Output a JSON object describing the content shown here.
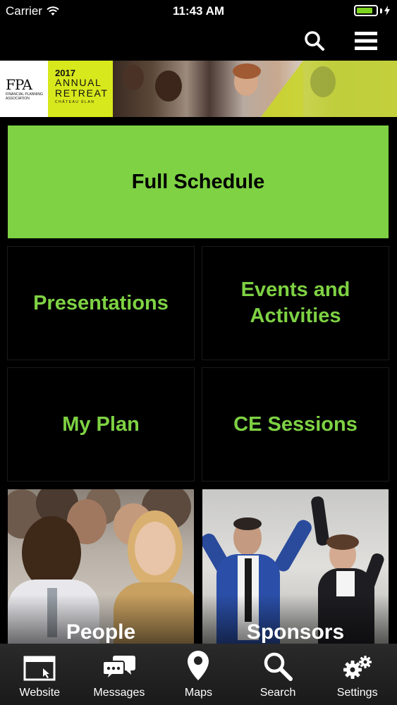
{
  "status_bar": {
    "carrier": "Carrier",
    "time": "11:43 AM",
    "battery_fill_fraction": 0.85
  },
  "navbar": {
    "search_icon": "search-icon",
    "menu_icon": "hamburger-menu-icon"
  },
  "banner": {
    "logo": "FPA",
    "logo_subtitle": "Financial Planning Association",
    "year": "2017",
    "event_line1": "ANNUAL",
    "event_line2": "RETREAT",
    "venue": "CHÂTEAU ÉLAN"
  },
  "tiles": {
    "full_schedule": "Full Schedule",
    "presentations": "Presentations",
    "events_line1": "Events and",
    "events_line2": "Activities",
    "my_plan": "My Plan",
    "ce_sessions": "CE Sessions",
    "people": "People",
    "sponsors": "Sponsors"
  },
  "tabbar": [
    {
      "label": "Website",
      "icon": "browser-window-icon"
    },
    {
      "label": "Messages",
      "icon": "chat-bubbles-icon"
    },
    {
      "label": "Maps",
      "icon": "map-pin-icon"
    },
    {
      "label": "Search",
      "icon": "search-icon"
    },
    {
      "label": "Settings",
      "icon": "gears-icon"
    }
  ],
  "colors": {
    "accent_green": "#7ed243",
    "banner_yellow": "#d7e81c",
    "background": "#000000"
  }
}
